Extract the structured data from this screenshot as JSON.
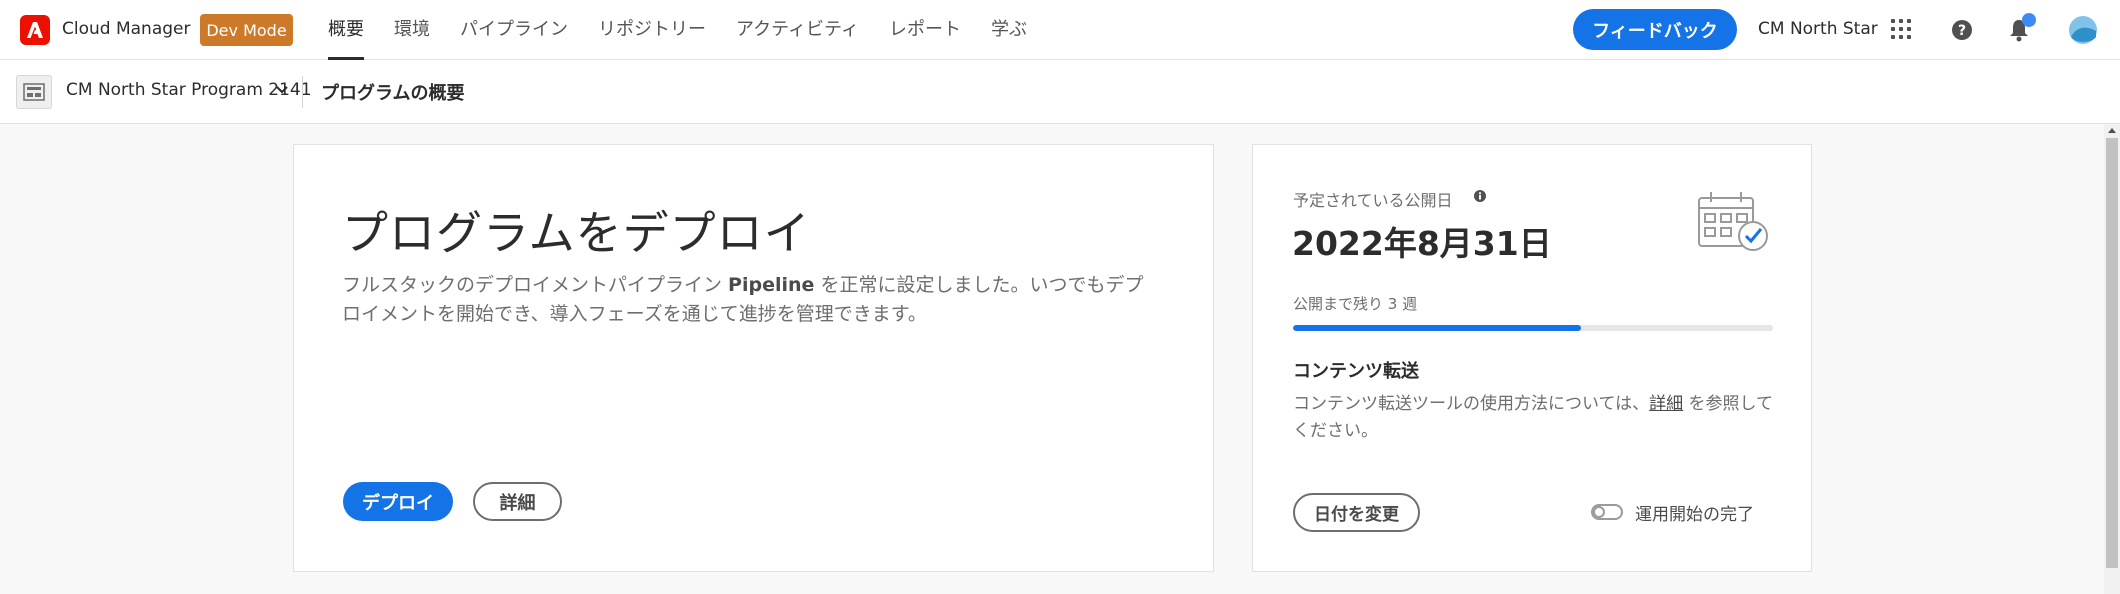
{
  "header": {
    "app_title": "Cloud Manager",
    "dev_mode_label": "Dev Mode",
    "nav": [
      "概要",
      "環境",
      "パイプライン",
      "リポジトリー",
      "アクティビティ",
      "レポート",
      "学ぶ"
    ],
    "active_nav": "概要",
    "feedback_label": "フィードバック",
    "org_name": "CM North Star",
    "icons": [
      "adobe-logo-icon",
      "apps-grid-icon",
      "help-icon",
      "notification-bell-icon",
      "avatar-icon"
    ]
  },
  "subheader": {
    "program_name": "CM North Star Program 2141",
    "page_title": "プログラムの概要"
  },
  "deploy_card": {
    "title": "プログラムをデプロイ",
    "desc_before": "フルスタックのデプロイメントパイプライン ",
    "desc_bold": "Pipeline",
    "desc_after": " を正常に設定しました。いつでもデプロイメントを開始でき、導入フェーズを通じて進捗を管理できます。",
    "deploy_label": "デプロイ",
    "details_label": "詳細"
  },
  "golive_card": {
    "label": "予定されている公開日",
    "date": "2022年8月31日",
    "progress_label": "公開まで残り 3 週",
    "progress_fraction": 0.6,
    "content_transfer_title": "コンテンツ転送",
    "content_transfer_before": "コンテンツ転送ツールの使用方法については、",
    "content_transfer_link": "詳細",
    "content_transfer_after": " を参照してください。",
    "change_date_label": "日付を変更",
    "toggle_label": "運用開始の完了",
    "toggle_on": false
  },
  "colors": {
    "accent": "#1473e6",
    "dev_mode": "#cc7a29",
    "adobe_red": "#eb1000"
  }
}
